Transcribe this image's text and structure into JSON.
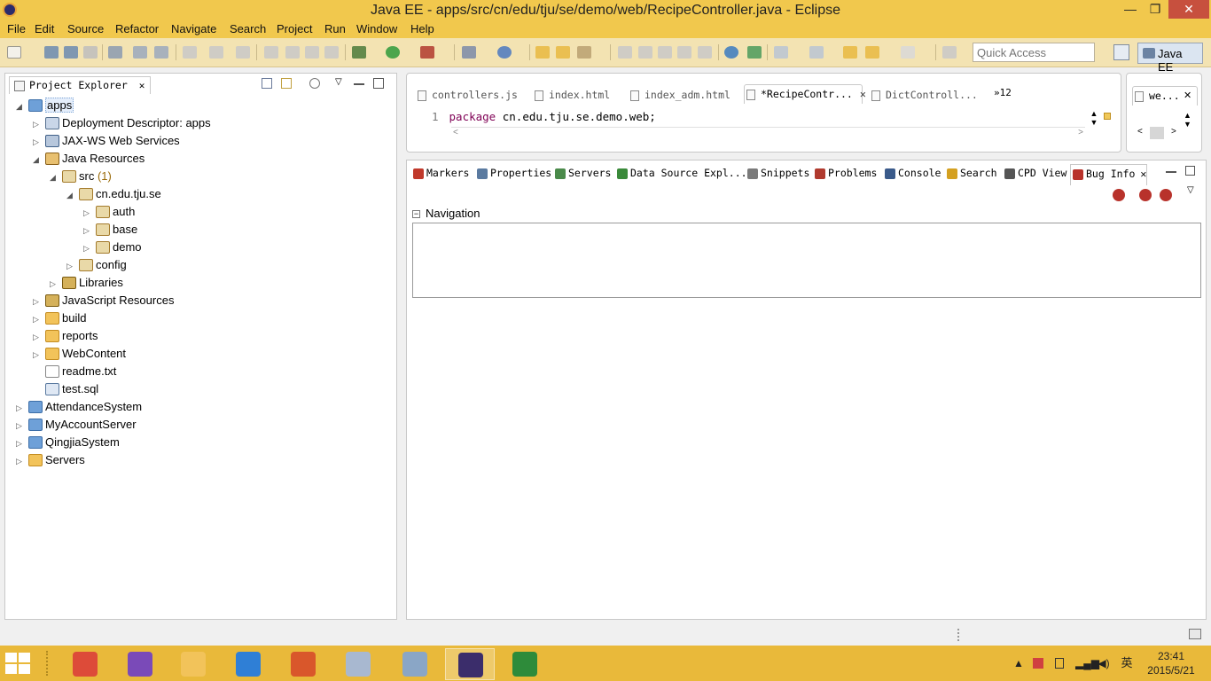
{
  "window": {
    "title": "Java EE - apps/src/cn/edu/tju/se/demo/web/RecipeController.java - Eclipse",
    "minimize": "—",
    "maximize": "❐",
    "close": "✕"
  },
  "menu": [
    "File",
    "Edit",
    "Source",
    "Refactor",
    "Navigate",
    "Search",
    "Project",
    "Run",
    "Window",
    "Help"
  ],
  "toolbar": {
    "quick_access_placeholder": "Quick Access",
    "perspective": "Java EE"
  },
  "explorer": {
    "tab_label": "Project Explorer",
    "tab_close": "✕",
    "tree": [
      {
        "label": "apps",
        "depth": 0,
        "expanded": true,
        "icon": "project",
        "selected": true
      },
      {
        "label": "Deployment Descriptor: apps",
        "depth": 1,
        "expanded": false,
        "icon": "descriptor"
      },
      {
        "label": "JAX-WS Web Services",
        "depth": 1,
        "expanded": false,
        "icon": "jaxws"
      },
      {
        "label": "Java Resources",
        "depth": 1,
        "expanded": true,
        "icon": "jres"
      },
      {
        "label": "src",
        "count": "(1)",
        "depth": 2,
        "expanded": true,
        "icon": "package"
      },
      {
        "label": "cn.edu.tju.se",
        "depth": 3,
        "expanded": true,
        "icon": "package"
      },
      {
        "label": "auth",
        "depth": 4,
        "expanded": false,
        "icon": "package"
      },
      {
        "label": "base",
        "depth": 4,
        "expanded": false,
        "icon": "package"
      },
      {
        "label": "demo",
        "depth": 4,
        "expanded": false,
        "icon": "package"
      },
      {
        "label": "config",
        "depth": 3,
        "expanded": false,
        "icon": "package"
      },
      {
        "label": "Libraries",
        "depth": 2,
        "expanded": false,
        "icon": "library"
      },
      {
        "label": "JavaScript Resources",
        "depth": 1,
        "expanded": false,
        "icon": "library"
      },
      {
        "label": "build",
        "depth": 1,
        "expanded": false,
        "icon": "folder"
      },
      {
        "label": "reports",
        "depth": 1,
        "expanded": false,
        "icon": "folder"
      },
      {
        "label": "WebContent",
        "depth": 1,
        "expanded": false,
        "icon": "folder"
      },
      {
        "label": "readme.txt",
        "depth": 1,
        "leaf": true,
        "icon": "file"
      },
      {
        "label": "test.sql",
        "depth": 1,
        "leaf": true,
        "icon": "sql"
      },
      {
        "label": "AttendanceSystem",
        "depth": 0,
        "expanded": false,
        "icon": "project"
      },
      {
        "label": "MyAccountServer",
        "depth": 0,
        "expanded": false,
        "icon": "project"
      },
      {
        "label": "QingjiaSystem",
        "depth": 0,
        "expanded": false,
        "icon": "project"
      },
      {
        "label": "Servers",
        "depth": 0,
        "expanded": false,
        "icon": "folder"
      }
    ]
  },
  "editor": {
    "tabs": [
      {
        "label": "controllers.js",
        "active": false
      },
      {
        "label": "index.html",
        "active": false
      },
      {
        "label": "index_adm.html",
        "active": false
      },
      {
        "label": "*RecipeContr...",
        "active": true
      },
      {
        "label": "DictControll...",
        "active": false
      }
    ],
    "tab_close": "✕",
    "overflow": "»12",
    "line_number": "1",
    "code_keyword": "package",
    "code_rest": " cn.edu.tju.se.demo.web;",
    "hscroll_left": "<",
    "hscroll_right": ">",
    "second_tab": "we...",
    "second_close": "✕"
  },
  "panel": {
    "tabs": [
      {
        "label": "Markers",
        "color": "#c0392b"
      },
      {
        "label": "Properties",
        "color": "#5a7aa0"
      },
      {
        "label": "Servers",
        "color": "#4a8a4a"
      },
      {
        "label": "Data Source Expl...",
        "color": "#3a8a3a"
      },
      {
        "label": "Snippets",
        "color": "#7a7a7a"
      },
      {
        "label": "Problems",
        "color": "#b03a2e"
      },
      {
        "label": "Console",
        "color": "#3a5a8a"
      },
      {
        "label": "Search",
        "color": "#d4a020"
      },
      {
        "label": "CPD View",
        "color": "#555555"
      },
      {
        "label": "Bug Info",
        "color": "#b8322b",
        "active": true
      }
    ],
    "tab_close": "✕",
    "section_title": "Navigation",
    "collapse_glyph": "−"
  },
  "taskbar": {
    "clock_time": "23:41",
    "clock_date": "2015/5/21",
    "ime": "英",
    "apps": [
      {
        "name": "chrome",
        "color": "#dd4b39"
      },
      {
        "name": "visual-studio",
        "color": "#7a4ab8"
      },
      {
        "name": "file-explorer",
        "color": "#f2c35a"
      },
      {
        "name": "messages",
        "color": "#2f7fd6"
      },
      {
        "name": "powerpoint",
        "color": "#d9572b"
      },
      {
        "name": "paint",
        "color": "#a8b8d0"
      },
      {
        "name": "monitor",
        "color": "#8aa6c6"
      },
      {
        "name": "eclipse-java-ee",
        "color": "#3b2d6b",
        "active": true
      },
      {
        "name": "draw-tool",
        "color": "#2e8b3a"
      }
    ]
  }
}
